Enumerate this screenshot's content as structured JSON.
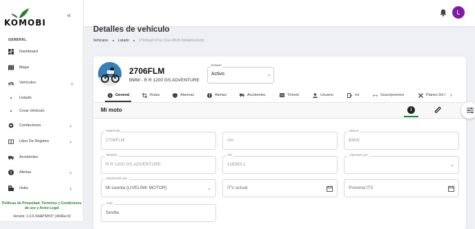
{
  "app": {
    "logo_text": "KOMOBI",
    "user_initial": "L",
    "avatar_color": "#7b1fa2",
    "accent_green": "#2e7d32"
  },
  "sidebar": {
    "section": "GENERAL",
    "items": [
      {
        "label": "Dashboard",
        "icon": "dashboard-icon"
      },
      {
        "label": "Mapa",
        "icon": "map-icon"
      },
      {
        "label": "Vehículos",
        "icon": "motorcycle-icon",
        "expanded": true
      },
      {
        "label": "Conductores",
        "icon": "drivers-icon"
      },
      {
        "label": "Libro De Registro",
        "icon": "book-icon"
      },
      {
        "label": "Accidentes",
        "icon": "accident-icon"
      },
      {
        "label": "Alertas",
        "icon": "alert-icon"
      },
      {
        "label": "Hubs",
        "icon": "hub-icon"
      }
    ],
    "sub_items": [
      {
        "label": "Listado"
      },
      {
        "label": "Crear Vehículo"
      }
    ],
    "privacy": "Políticas de Privacidad, Términos y Condiciones de uso y Aviso Legal",
    "version": "Versión: 1.0.0-SNAPSHOT (4646ec0)"
  },
  "page": {
    "title": "Detalles de vehículo",
    "breadcrumb": [
      "Vehículos",
      "Listado",
      "172c6aa0-07a1-11ee-8518-3ddad0ce2eb9"
    ]
  },
  "vehicle": {
    "plate": "2706FLM",
    "model": "BMW - R R 1200 GS ADVENTURE",
    "estado_label": "Estado",
    "estado_value": "Activo"
  },
  "tabs": [
    {
      "label": "General",
      "icon": "info-icon",
      "active": true
    },
    {
      "label": "Rutas",
      "icon": "routes-icon"
    },
    {
      "label": "Alarmas",
      "icon": "shield-icon"
    },
    {
      "label": "Alertas",
      "icon": "alert-icon"
    },
    {
      "label": "Accidentes",
      "icon": "accident-icon"
    },
    {
      "label": "Tickets",
      "icon": "ticket-icon"
    },
    {
      "label": "Usuario",
      "icon": "user-icon"
    },
    {
      "label": "Iot",
      "icon": "iot-icon"
    },
    {
      "label": "Suscripciones",
      "icon": "subscription-icon"
    },
    {
      "label": "Planes De I",
      "icon": "tools-icon"
    }
  ],
  "section_title": "Mi moto",
  "form": {
    "matricula": {
      "label": "Matricula",
      "value": "2706FLM"
    },
    "vin": {
      "label": "",
      "value": "Vin"
    },
    "marca": {
      "label": "Marca",
      "value": "BMW"
    },
    "modelo": {
      "label": "Modelo",
      "value": "R R 1200 GS ADVENTURE"
    },
    "km": {
      "label": "km",
      "value": "118383.1"
    },
    "operado_por": {
      "label": "Operado por",
      "value": ""
    },
    "mantenido_por": {
      "label": "Mantenido por",
      "value": "Mi cuenta (LIVELINK MOTOR)"
    },
    "itv_actual": {
      "label": "",
      "value": "ITV actual"
    },
    "proxima_itv": {
      "label": "",
      "value": "Próxima ITV"
    },
    "hub": {
      "label": "Hub",
      "value": "Sevilla"
    }
  }
}
